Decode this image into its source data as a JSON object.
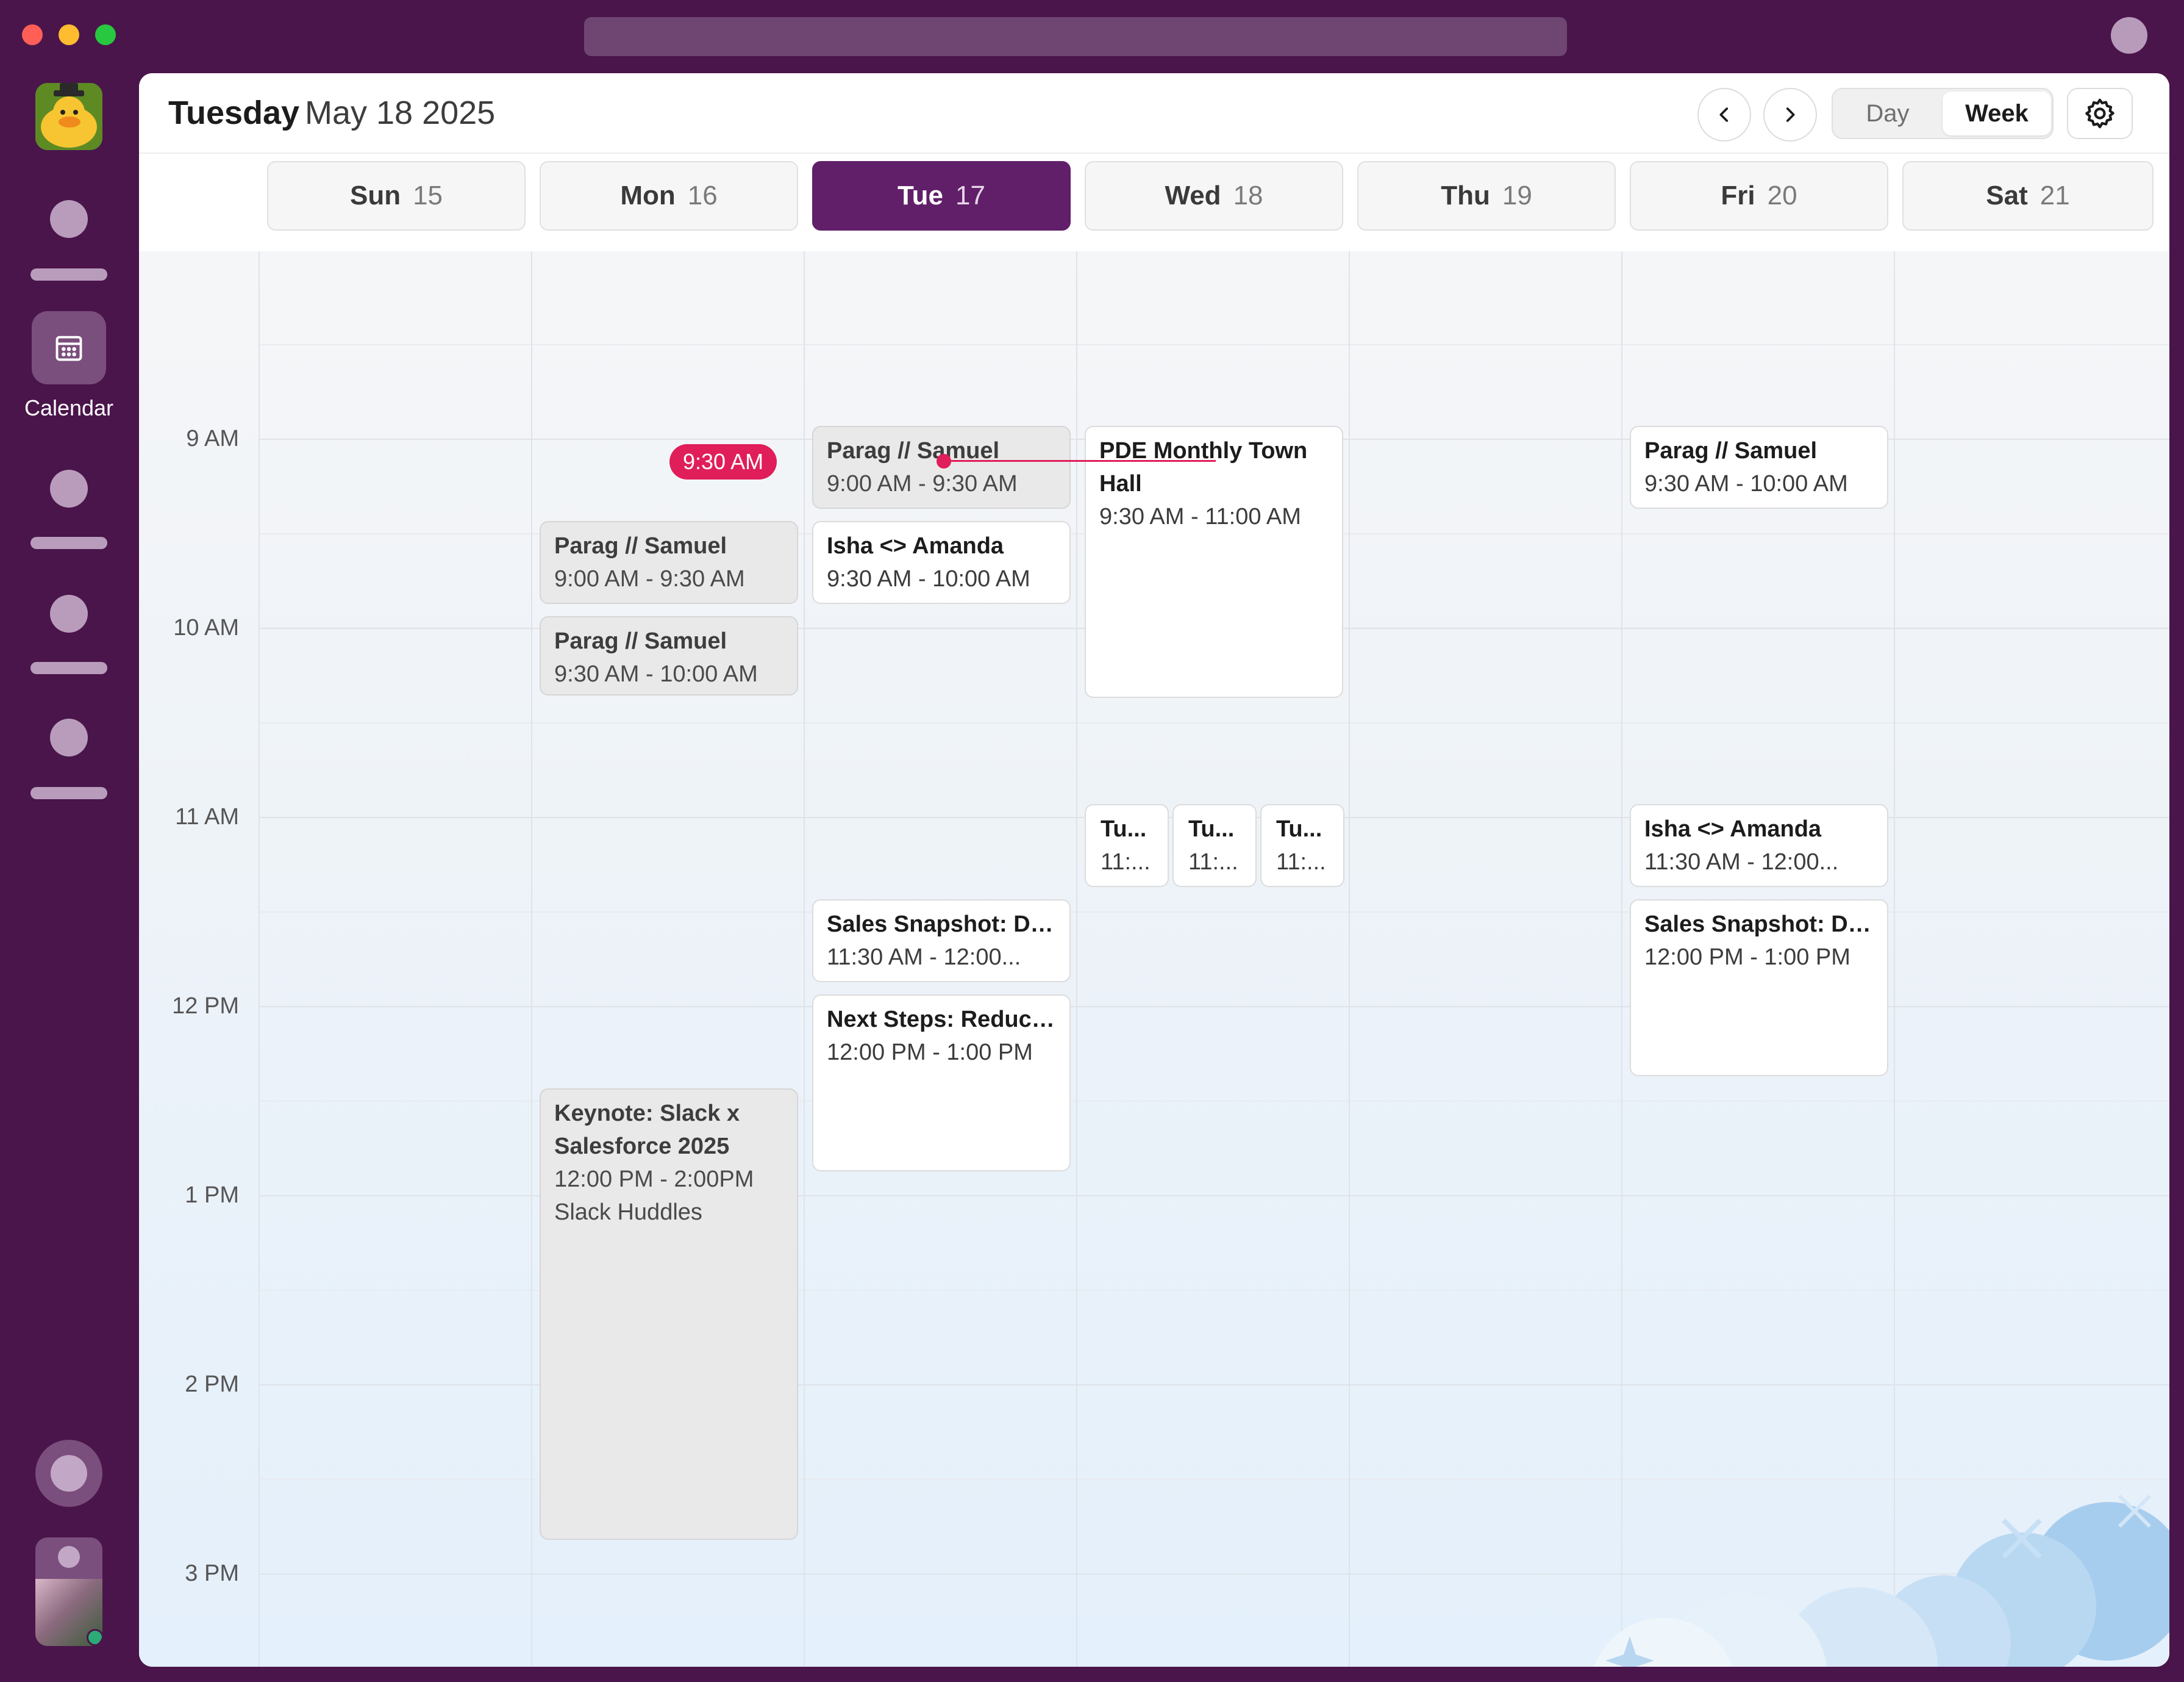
{
  "header": {
    "day": "Tuesday",
    "date": "May 18 2025"
  },
  "view": {
    "day_label": "Day",
    "week_label": "Week",
    "selected": "Week"
  },
  "rail": {
    "calendar_label": "Calendar"
  },
  "days": [
    {
      "name": "Sun",
      "num": "15"
    },
    {
      "name": "Mon",
      "num": "16"
    },
    {
      "name": "Tue",
      "num": "17"
    },
    {
      "name": "Wed",
      "num": "18"
    },
    {
      "name": "Thu",
      "num": "19"
    },
    {
      "name": "Fri",
      "num": "20"
    },
    {
      "name": "Sat",
      "num": "21"
    }
  ],
  "times": [
    "9 AM",
    "10 AM",
    "11 AM",
    "12 PM",
    "1 PM",
    "2 PM",
    "3 PM"
  ],
  "now": {
    "label": "9:30 AM"
  },
  "events": {
    "mon_parag_1": {
      "title": "Parag // Samuel",
      "time": "9:00 AM - 9:30 AM"
    },
    "mon_parag_2": {
      "title": "Parag // Samuel",
      "time": "9:30 AM - 10:00 AM"
    },
    "mon_keynote": {
      "title": "Keynote: Slack x Salesforce 2025",
      "time": "12:00 PM - 2:00PM",
      "location": "Slack Huddles"
    },
    "tue_parag": {
      "title": "Parag // Samuel",
      "time": "9:00 AM - 9:30 AM"
    },
    "tue_isha": {
      "title": "Isha <> Amanda",
      "time": "9:30 AM - 10:00 AM"
    },
    "tue_sales": {
      "title": "Sales Snapshot: De...",
      "time": "11:30 AM - 12:00..."
    },
    "tue_next": {
      "title": "Next Steps: Reduci...",
      "time": "12:00 PM - 1:00 PM"
    },
    "wed_pde": {
      "title": "PDE Monthly Town Hall",
      "time": "9:30 AM - 11:00 AM"
    },
    "wed_tu_1": {
      "title": "Tu...",
      "time": "11:..."
    },
    "wed_tu_2": {
      "title": "Tu...",
      "time": "11:..."
    },
    "wed_tu_3": {
      "title": "Tu...",
      "time": "11:..."
    },
    "fri_parag": {
      "title": "Parag // Samuel",
      "time": "9:30 AM - 10:00 AM"
    },
    "fri_isha": {
      "title": "Isha <> Amanda",
      "time": "11:30 AM - 12:00..."
    },
    "fri_sales": {
      "title": "Sales Snapshot: De...",
      "time": "12:00 PM - 1:00 PM"
    }
  },
  "colors": {
    "frame": "#4a154b",
    "active_day": "#611f69",
    "now_indicator": "#e01e5a",
    "status_online": "#2bac76"
  },
  "icons": [
    "app-logo-duck-icon",
    "calendar-icon",
    "chevron-left-icon",
    "chevron-right-icon",
    "gear-icon",
    "avatar-photo"
  ]
}
